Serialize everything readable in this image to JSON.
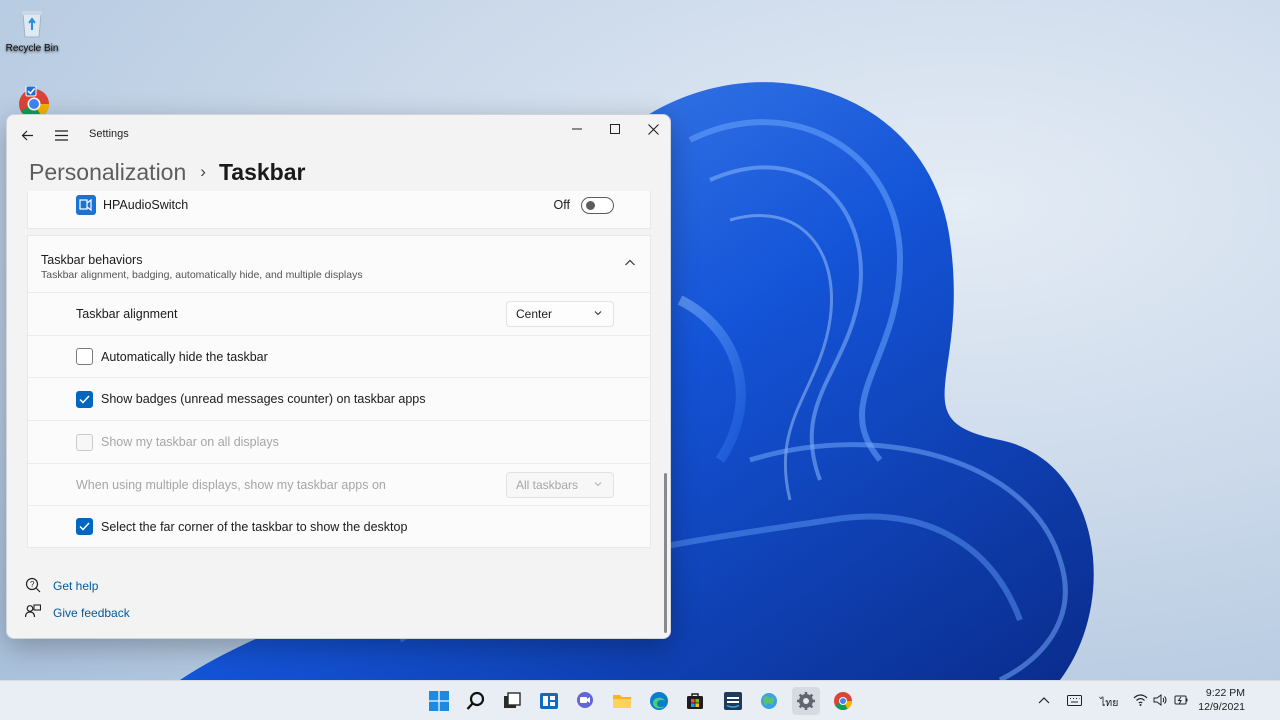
{
  "desktop": {
    "icons": [
      {
        "label": "Recycle Bin",
        "icon": "recycle-bin-icon"
      },
      {
        "label": "",
        "icon": "chrome-icon"
      }
    ]
  },
  "window": {
    "app_title": "Settings",
    "breadcrumb": {
      "parent": "Personalization",
      "separator": "›",
      "current": "Taskbar"
    },
    "hpaudio": {
      "label": "HPAudioSwitch",
      "state_label": "Off",
      "enabled": false
    },
    "behaviors": {
      "title": "Taskbar behaviors",
      "subtitle": "Taskbar alignment, badging, automatically hide, and multiple displays",
      "alignment": {
        "label": "Taskbar alignment",
        "value": "Center"
      },
      "auto_hide": {
        "label": "Automatically hide the taskbar",
        "checked": false
      },
      "badges": {
        "label": "Show badges (unread messages counter) on taskbar apps",
        "checked": true
      },
      "all_displays": {
        "label": "Show my taskbar on all displays",
        "checked": false,
        "disabled": true
      },
      "multi_display": {
        "label": "When using multiple displays, show my taskbar apps on",
        "value": "All taskbars",
        "disabled": true
      },
      "far_corner": {
        "label": "Select the far corner of the taskbar to show the desktop",
        "checked": true
      }
    },
    "links": {
      "help": "Get help",
      "feedback": "Give feedback"
    }
  },
  "taskbar": {
    "apps": [
      "start-icon",
      "search-icon",
      "task-view-icon",
      "widgets-icon",
      "chat-icon",
      "file-explorer-icon",
      "edge-icon",
      "store-icon",
      "prime-video-icon",
      "weather-app-icon",
      "settings-icon",
      "chrome-icon"
    ],
    "tray": {
      "language": "ไทย",
      "time": "9:22 PM",
      "date": "12/9/2021"
    }
  },
  "colors": {
    "accent": "#0067c0",
    "link": "#005a9e"
  }
}
